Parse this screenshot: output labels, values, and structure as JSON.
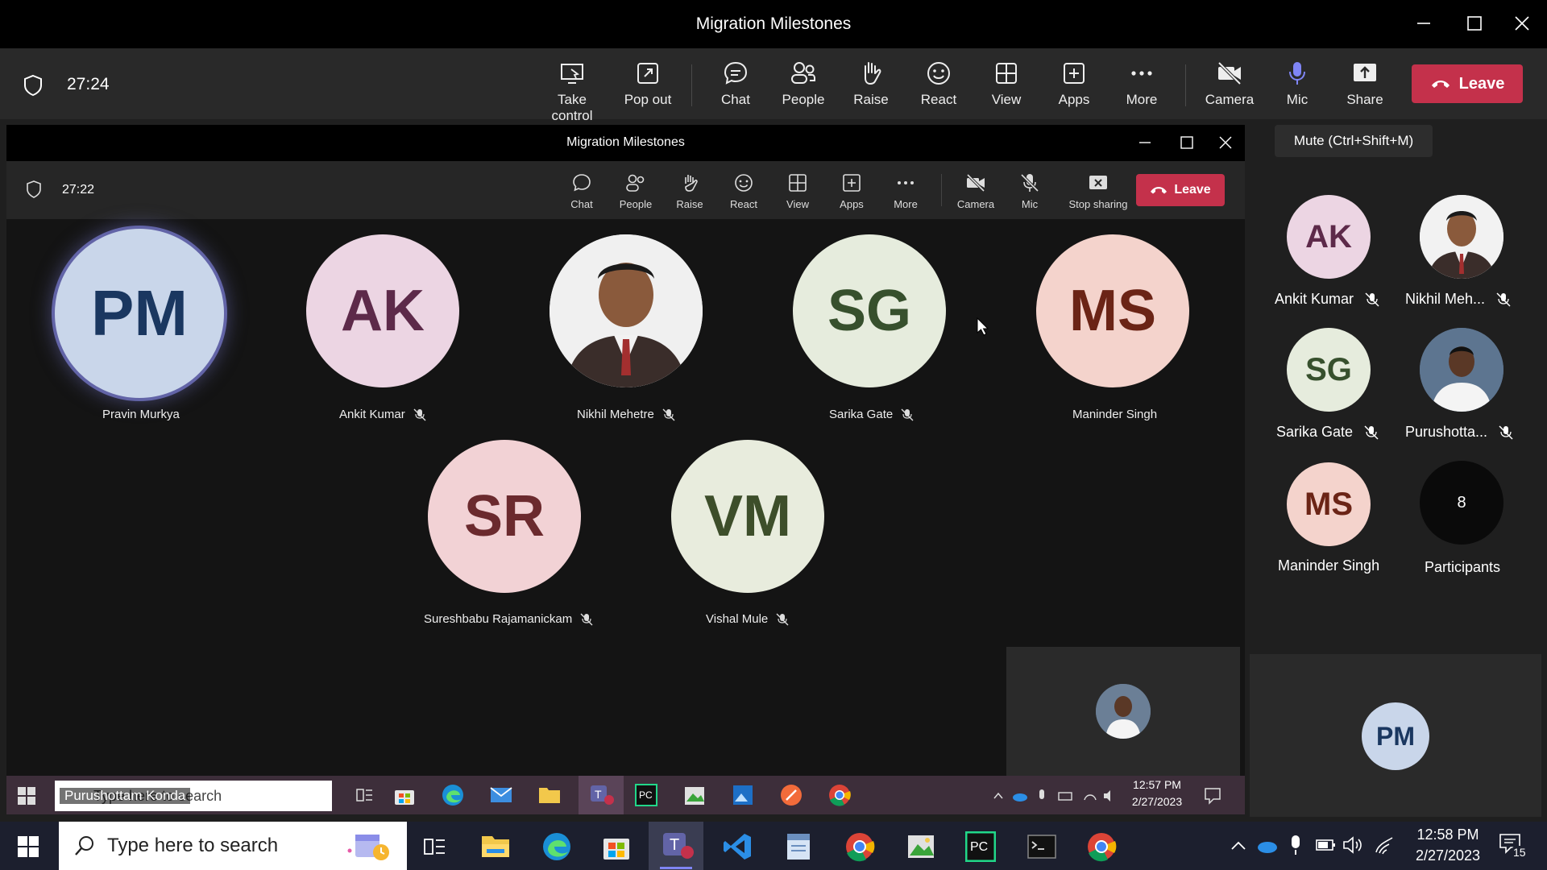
{
  "window": {
    "title": "Migration Milestones"
  },
  "toolbar": {
    "timer": "27:24",
    "buttons": [
      "Take control",
      "Pop out",
      "Chat",
      "People",
      "Raise",
      "React",
      "View",
      "Apps",
      "More",
      "Camera",
      "Mic",
      "Share"
    ],
    "leave_label": "Leave"
  },
  "tooltip": "Mute (Ctrl+Shift+M)",
  "inner": {
    "title": "Migration Milestones",
    "timer": "27:22",
    "buttons": [
      "Chat",
      "People",
      "Raise",
      "React",
      "View",
      "Apps",
      "More",
      "Camera",
      "Mic",
      "Stop sharing"
    ],
    "leave_label": "Leave",
    "tiles": [
      {
        "initials": "PM",
        "name": "Pravin Murkya",
        "bg": "#c9d6ea",
        "fg": "#1a3760"
      },
      {
        "initials": "AK",
        "name": "Ankit Kumar",
        "bg": "#ecd5e3",
        "fg": "#5d2a4a"
      },
      {
        "initials": "",
        "name": "Nikhil Mehetre",
        "bg": "#eeeeee",
        "fg": "#333"
      },
      {
        "initials": "SG",
        "name": "Sarika Gate",
        "bg": "#e6ecdd",
        "fg": "#37502d"
      },
      {
        "initials": "MS",
        "name": "Maninder Singh",
        "bg": "#f4d3cc",
        "fg": "#6b2416"
      },
      {
        "initials": "SR",
        "name": "Sureshbabu Rajamanickam",
        "bg": "#f2d2d5",
        "fg": "#6b2a2e"
      },
      {
        "initials": "VM",
        "name": "Vishal Mule",
        "bg": "#e8ecdd",
        "fg": "#3d4e2a"
      }
    ],
    "self_view_name": "Purushottam Konda",
    "taskbar": {
      "search_placeholder": "Type here to search",
      "time": "12:57 PM",
      "date": "2/27/2023"
    }
  },
  "right_panel": {
    "participants": [
      {
        "initials": "AK",
        "name": "Ankit Kumar",
        "bg": "#ecd5e3",
        "fg": "#5d2a4a"
      },
      {
        "initials": "",
        "name": "Nikhil Meh...",
        "bg": "#eeeeee",
        "fg": "#333"
      },
      {
        "initials": "SG",
        "name": "Sarika Gate",
        "bg": "#e6ecdd",
        "fg": "#37502d"
      },
      {
        "initials": "",
        "name": "Purushotta...",
        "bg": "#5a6f88",
        "fg": "#fff"
      },
      {
        "initials": "MS",
        "name": "Maninder Singh",
        "bg": "#f4d3cc",
        "fg": "#6b2416"
      }
    ],
    "participant_count": "8",
    "participant_label": "Participants",
    "self_initials": "PM"
  },
  "taskbar": {
    "search_placeholder": "Type here to search",
    "time": "12:58 PM",
    "date": "2/27/2023",
    "notification_count": "15"
  },
  "colors": {
    "leave": "#c4314b",
    "accent": "#6264a7",
    "mic_active": "#7f85f5"
  }
}
